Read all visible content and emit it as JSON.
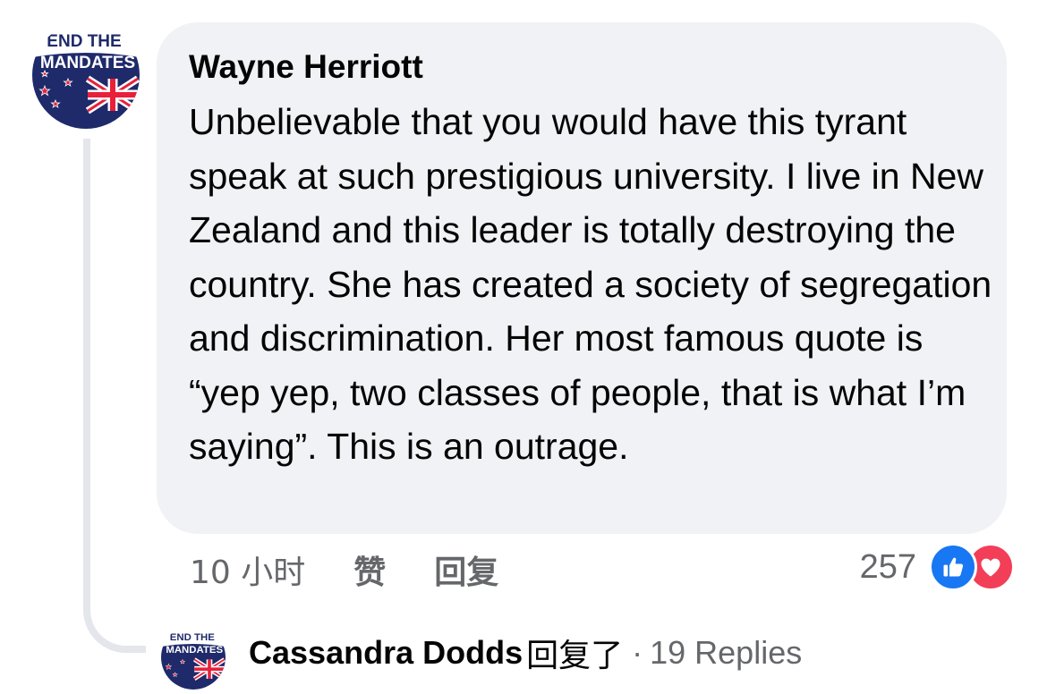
{
  "avatar": {
    "line1": "END THE",
    "line2": "MANDATES"
  },
  "comment": {
    "author": "Wayne Herriott",
    "text": "Unbelievable that you would have this tyrant speak at such prestigious university. I live in New Zealand and this leader is totally destroying the country. She has created a society of segregation and discrimination. Her most famous quote is “yep yep, two classes of people, that is what I’m saying”. This is an outrage.",
    "time": "10 小时",
    "like_label": "赞",
    "reply_label": "回复",
    "reaction_count": "257",
    "reactions": [
      "like-icon",
      "love-icon"
    ]
  },
  "replies": {
    "author": "Cassandra Dodds",
    "verb": "回复了",
    "separator": "·",
    "count_label": "19 Replies"
  },
  "colors": {
    "bubble": "#f0f2f5",
    "secondary_text": "#65676b",
    "like_blue": "#1877f2",
    "love_red": "#f33e58",
    "thread_line": "#e4e6eb",
    "flag_navy": "#1f2a6b"
  }
}
